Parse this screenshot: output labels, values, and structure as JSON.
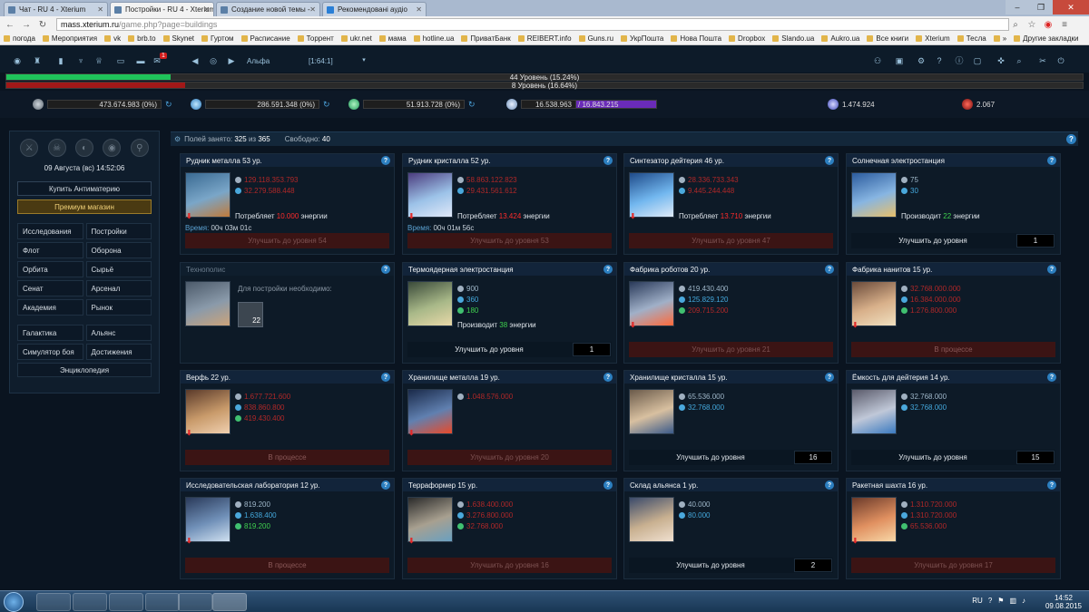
{
  "browser": {
    "tabs": [
      {
        "title": "Чат - RU 4 - Xterium"
      },
      {
        "title": "Постройки - RU 4 - Xterium"
      },
      {
        "title": "Создание новой темы -"
      },
      {
        "title": "Рекомендовані аудіо"
      }
    ],
    "url_host": "mass.xterium.ru",
    "url_path": "/game.php?page=buildings",
    "bookmarks": [
      "погода",
      "Мероприятия",
      "vk",
      "brb.to",
      "Skynet",
      "Гуртом",
      "Расписание",
      "Торрент",
      "ukr.net",
      "мама",
      "hotline.ua",
      "ПриватБанк",
      "REIBERT.info",
      "Guns.ru",
      "УкрПошта",
      "Нова Пошта",
      "Dropbox",
      "Slando.ua",
      "Aukro.ua",
      "Все книги",
      "Xterium",
      "Тесла",
      "»",
      "Другие закладки"
    ]
  },
  "gametop": {
    "planet_name": "Альфа",
    "coords": "[1:64:1]",
    "mail_badge": "1"
  },
  "levels": [
    {
      "text": "44 Уровень (15.24%)",
      "progress": 0.1524,
      "color": "#1fc35a"
    },
    {
      "text": "8 Уровень (16.64%)",
      "progress": 0.1664,
      "color": "#a11818"
    }
  ],
  "resources": {
    "metal": "473.674.983 (0%)",
    "crystal": "286.591.348 (0%)",
    "deuterium": "51.913.728 (0%)",
    "energy_used": "16.538.963",
    "energy_max": "/ 16.843.215",
    "antimatter": "1.474.924",
    "darkmatter": "2.067"
  },
  "left_panel": {
    "date": "09 Августа (вс) 14:52:06",
    "buy_antimatter": "Купить Антиматерию",
    "premium_shop": "Премиум магазин",
    "menu1": [
      "Исследования",
      "Постройки",
      "Флот",
      "Оборона",
      "Орбита",
      "Сырьё",
      "Сенат",
      "Арсенал",
      "Академия",
      "Рынок"
    ],
    "menu2": [
      "Галактика",
      "Альянс",
      "Симулятор боя",
      "Достижения"
    ],
    "encyclopedia": "Энциклопедия"
  },
  "main_header": {
    "fields_label": "Полей занято:",
    "fields_used": "325",
    "fields_of": "из",
    "fields_total": "365",
    "free_label": "Свободно:",
    "free_value": "40"
  },
  "buildings": [
    {
      "title": "Рудник металла 53 ур.",
      "r": [
        {
          "t": "129.118.353.793",
          "c": "red"
        },
        {
          "t": "32.279.588.448",
          "c": "red"
        }
      ],
      "info": "Потребляет ",
      "infoval": "10.000",
      "infoval_c": "redtxt",
      "info2": " энергии",
      "time_label": "Время:",
      "time": "00ч 03м 01с",
      "action": "Улучшить до уровня 54",
      "action_type": "up-red",
      "arrow": true
    },
    {
      "title": "Рудник кристалла 52 ур.",
      "r": [
        {
          "t": "58.863.122.823",
          "c": "red"
        },
        {
          "t": "29.431.561.612",
          "c": "red"
        }
      ],
      "info": "Потребляет ",
      "infoval": "13.424",
      "infoval_c": "redtxt",
      "info2": " энергии",
      "time_label": "Время:",
      "time": "00ч 01м 56с",
      "action": "Улучшить до уровня 53",
      "action_type": "up-red",
      "arrow": true
    },
    {
      "title": "Синтезатор дейтерия 46 ур.",
      "r": [
        {
          "t": "28.336.733.343",
          "c": "red"
        },
        {
          "t": "9.445.244.448",
          "c": "red"
        }
      ],
      "info": "Потребляет ",
      "infoval": "13.710",
      "infoval_c": "redtxt",
      "info2": " энергии",
      "action": "Улучшить до уровня 47",
      "action_type": "up-red",
      "arrow": true
    },
    {
      "title": "Солнечная электростанция",
      "r": [
        {
          "t": "75",
          "c": "dim"
        },
        {
          "t": "30",
          "c": "blue"
        }
      ],
      "info": "Производит ",
      "infoval": "22",
      "infoval_c": "green",
      "info2": " энергии",
      "action": "Улучшить до уровня",
      "level": "1",
      "action_type": "up-ok"
    },
    {
      "title": "Технополис",
      "muted": true,
      "needs": "Для постройки необходимо:",
      "needs_lvl": "22"
    },
    {
      "title": "Термоядерная электростанция",
      "r": [
        {
          "t": "900",
          "c": "dim"
        },
        {
          "t": "360",
          "c": "blue"
        },
        {
          "t": "180",
          "c": "green"
        }
      ],
      "info": "Производит ",
      "infoval": "38",
      "infoval_c": "green",
      "info2": " энергии",
      "action": "Улучшить до уровня",
      "level": "1",
      "action_type": "up-ok"
    },
    {
      "title": "Фабрика роботов 20 ур.",
      "r": [
        {
          "t": "419.430.400",
          "c": "dim"
        },
        {
          "t": "125.829.120",
          "c": "blue"
        },
        {
          "t": "209.715.200",
          "c": "red"
        }
      ],
      "action": "Улучшить до уровня 21",
      "action_type": "up-red",
      "arrow": true
    },
    {
      "title": "Фабрика нанитов 15 ур.",
      "r": [
        {
          "t": "32.768.000.000",
          "c": "red"
        },
        {
          "t": "16.384.000.000",
          "c": "red"
        },
        {
          "t": "1.276.800.000",
          "c": "red"
        }
      ],
      "action": "В процессе",
      "action_type": "progress",
      "arrow": true
    },
    {
      "title": "Верфь 22 ур.",
      "r": [
        {
          "t": "1.677.721.600",
          "c": "red"
        },
        {
          "t": "838.860.800",
          "c": "red"
        },
        {
          "t": "419.430.400",
          "c": "red"
        }
      ],
      "action": "В процессе",
      "action_type": "progress",
      "arrow": true
    },
    {
      "title": "Хранилище металла 19 ур.",
      "r": [
        {
          "t": "1.048.576.000",
          "c": "red"
        }
      ],
      "action": "Улучшить до уровня 20",
      "action_type": "up-red",
      "arrow": true
    },
    {
      "title": "Хранилище кристалла 15 ур.",
      "r": [
        {
          "t": "65.536.000",
          "c": "dim"
        },
        {
          "t": "32.768.000",
          "c": "blue"
        }
      ],
      "action": "Улучшить до уровня",
      "level": "16",
      "action_type": "up-ok"
    },
    {
      "title": "Ёмкость для дейтерия 14 ур.",
      "r": [
        {
          "t": "32.768.000",
          "c": "dim"
        },
        {
          "t": "32.768.000",
          "c": "blue"
        }
      ],
      "action": "Улучшить до уровня",
      "level": "15",
      "action_type": "up-ok"
    },
    {
      "title": "Исследовательская лаборатория 12 ур.",
      "r": [
        {
          "t": "819.200",
          "c": "dim"
        },
        {
          "t": "1.638.400",
          "c": "blue"
        },
        {
          "t": "819.200",
          "c": "green"
        }
      ],
      "action": "В процессе",
      "action_type": "progress",
      "arrow": true
    },
    {
      "title": "Терраформер 15 ур.",
      "r": [
        {
          "t": "1.638.400.000",
          "c": "red"
        },
        {
          "t": "3.276.800.000",
          "c": "red"
        },
        {
          "t": "32.768.000",
          "c": "red"
        }
      ],
      "action": "Улучшить до уровня 16",
      "action_type": "up-red",
      "arrow": true
    },
    {
      "title": "Склад альянса 1 ур.",
      "r": [
        {
          "t": "40.000",
          "c": "dim"
        },
        {
          "t": "80.000",
          "c": "blue"
        }
      ],
      "action": "Улучшить до уровня",
      "level": "2",
      "action_type": "up-ok"
    },
    {
      "title": "Ракетная шахта 16 ур.",
      "r": [
        {
          "t": "1.310.720.000",
          "c": "red"
        },
        {
          "t": "1.310.720.000",
          "c": "red"
        },
        {
          "t": "65.536.000",
          "c": "red"
        }
      ],
      "action": "Улучшить до уровня 17",
      "action_type": "up-red",
      "arrow": true
    }
  ],
  "taskbar": {
    "lang": "RU",
    "time": "14:52",
    "date": "09.08.2015"
  }
}
